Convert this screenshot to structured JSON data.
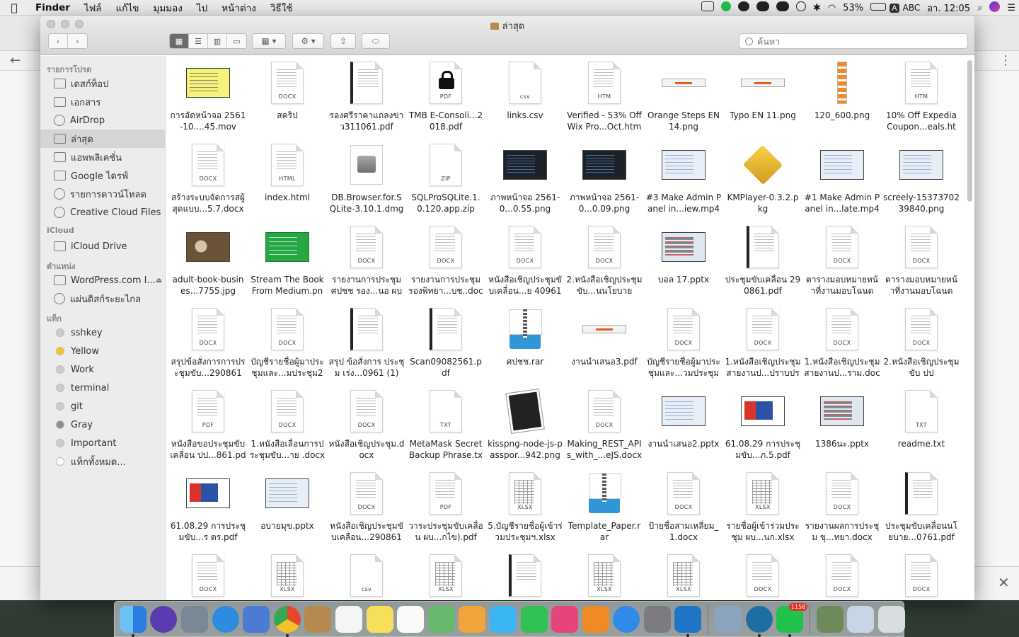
{
  "menubar": {
    "app": "Finder",
    "items": [
      "ไฟล์",
      "แก้ไข",
      "มุมมอง",
      "ไป",
      "หน้าต่าง",
      "วิธีใช้"
    ],
    "battery": "53%",
    "input": "ABC",
    "clock": "อา. 12:05",
    "input_badge": "A"
  },
  "window": {
    "title": "ล่าสุด",
    "search_placeholder": "ค้นหา"
  },
  "sidebar": {
    "favorites_head": "รายการโปรด",
    "favorites": [
      "เดสก์ท็อป",
      "เอกสาร",
      "AirDrop",
      "ล่าสุด",
      "แอพพลิเคชั่น",
      "Google ไดรฟ์",
      "รายการดาวน์โหลด",
      "Creative Cloud Files"
    ],
    "icloud_head": "iCloud",
    "icloud": [
      "iCloud Drive"
    ],
    "locations_head": "ตำแหน่ง",
    "locations": [
      "WordPress.com I...",
      "แผ่นดิสก์ระยะไกล"
    ],
    "tags_head": "แท็ก",
    "tags": [
      {
        "name": "sshkey",
        "color": "#cccccc"
      },
      {
        "name": "Yellow",
        "color": "#f5c518"
      },
      {
        "name": "Work",
        "color": "#cccccc"
      },
      {
        "name": "terminal",
        "color": "#cccccc"
      },
      {
        "name": "git",
        "color": "#cccccc"
      },
      {
        "name": "Gray",
        "color": "#8e8e8e"
      },
      {
        "name": "Important",
        "color": "#cccccc"
      },
      {
        "name": "แท็กทั้งหมด...",
        "color": "#ffffff"
      }
    ]
  },
  "files": [
    {
      "name": "การอัดหน้าจอ 2561-10....45.mov",
      "kind": "shot-yellow"
    },
    {
      "name": "สคริป",
      "kind": "doc",
      "ext": "DOCX"
    },
    {
      "name": "รองศรีราคาแถลงข่าว311061.pdf",
      "kind": "spiral"
    },
    {
      "name": "TMB E-Consoli...2018.pdf",
      "kind": "lock",
      "ext": "PDF"
    },
    {
      "name": "links.csv",
      "kind": "plain",
      "ext": "csv"
    },
    {
      "name": "Verified - 53% Off Wix Pro...Oct.htm",
      "kind": "doc",
      "ext": "HTM"
    },
    {
      "name": "Orange Steps EN 14.png",
      "kind": "banner"
    },
    {
      "name": "Typo EN 11.png",
      "kind": "banner"
    },
    {
      "name": "120_600.png",
      "kind": "tall"
    },
    {
      "name": "10% Off Expedia Coupon...eals.htm",
      "kind": "doc",
      "ext": "HTM"
    },
    {
      "name": "สร้างระบบจัดการสผู้สุดแบบ...5.7.docx",
      "kind": "doc",
      "ext": "DOCX"
    },
    {
      "name": "index.html",
      "kind": "doc",
      "ext": "HTML"
    },
    {
      "name": "DB.Browser.for.SQLite-3.10.1.dmg",
      "kind": "disk"
    },
    {
      "name": "SQLProSQLite.1.0.120.app.zip",
      "kind": "plain",
      "ext": "ZIP"
    },
    {
      "name": "ภาพหน้าจอ 2561-0...0.55.png",
      "kind": "shot"
    },
    {
      "name": "ภาพหน้าจอ 2561-0...0.09.png",
      "kind": "shot"
    },
    {
      "name": "#3 Make Admin Panel in...iew.mp4",
      "kind": "shot-light"
    },
    {
      "name": "KMPlayer-0.3.2.pkg",
      "kind": "pkg"
    },
    {
      "name": "#1 Make Admin Panel in...late.mp4",
      "kind": "shot-light"
    },
    {
      "name": "screely-1537370239840.png",
      "kind": "shot-light"
    },
    {
      "name": "adult-book-busines...7755.jpg",
      "kind": "shot-photo"
    },
    {
      "name": "Stream The Book From Medium.png",
      "kind": "shot-green"
    },
    {
      "name": "รายงานการประชุม ศปชช รอง...นอ ผบช.",
      "kind": "doc",
      "ext": "DOCX"
    },
    {
      "name": "รายงานการประชุม รองพิทยา...บช..docx",
      "kind": "doc",
      "ext": "DOCX"
    },
    {
      "name": "หนังสือเชิญประชุมขับเคลื่อน...ย 40961",
      "kind": "doc",
      "ext": "DOCX"
    },
    {
      "name": "2.หนังสือเชิญประชุมขับ...นนโยบาย",
      "kind": "doc",
      "ext": "DOCX"
    },
    {
      "name": "บอล 17.pptx",
      "kind": "shot-sheet"
    },
    {
      "name": "ประชุมขับเคลื่อน 290861.pdf",
      "kind": "spiral"
    },
    {
      "name": "ตารางมอบหมายหน้าที่งานมอบโฉนด",
      "kind": "doc",
      "ext": "DOCX"
    },
    {
      "name": "ตารางมอบหมายหน้าที่งานมอบโฉนด",
      "kind": "doc",
      "ext": "DOCX"
    },
    {
      "name": "สรุปข้อสั่งการการประชุมขับ...290861",
      "kind": "doc",
      "ext": "DOCX"
    },
    {
      "name": "บัญชีรายชื่อผู้มาประชุมและ...มประชุม2",
      "kind": "doc",
      "ext": "DOCX"
    },
    {
      "name": "สรุป ข้อสั่งการ ประชุม เร่ง...0961 (1)",
      "kind": "spiral"
    },
    {
      "name": "Scan09082561.pdf",
      "kind": "spiral"
    },
    {
      "name": "ศปชช.rar",
      "kind": "zip"
    },
    {
      "name": "งานนำเสนอ3.pdf",
      "kind": "banner"
    },
    {
      "name": "บัญชีรายชื่อผู้มาประชุมและ...วมประชุม",
      "kind": "doc",
      "ext": "DOCX"
    },
    {
      "name": "1.หนังสือเชิญประชุมสายงานป...ปราบปราม",
      "kind": "doc",
      "ext": "DOCX"
    },
    {
      "name": "1.หนังสือเชิญประชุมสายงานป...ราม.docx",
      "kind": "doc",
      "ext": "DOCX"
    },
    {
      "name": "2.หนังสือเชิญประชุมขับ ปป",
      "kind": "doc",
      "ext": "DOCX"
    },
    {
      "name": "หนังสือขอประชุมขับเคลื่อน ปป...861.pdf",
      "kind": "doc",
      "ext": "PDF"
    },
    {
      "name": "1.หนังสือเลื่อนการประชุมขับ...าย .docx",
      "kind": "doc",
      "ext": "DOCX"
    },
    {
      "name": "หนังสือเชิญประชุม.docx",
      "kind": "doc",
      "ext": "DOCX"
    },
    {
      "name": "MetaMask Secret Backup Phrase.txt",
      "kind": "plain",
      "ext": "TXT"
    },
    {
      "name": "kisspng-node-js-passpor...942.png",
      "kind": "kiss"
    },
    {
      "name": "Making_REST_APIs_with_...eJS.docx",
      "kind": "doc",
      "ext": "DOCX"
    },
    {
      "name": "งานนำเสนอ2.pptx",
      "kind": "shot-light"
    },
    {
      "name": "61.08.29 การประชุมขับ...ภ.5.pdf",
      "kind": "shot-redblue"
    },
    {
      "name": "1386นะ.pptx",
      "kind": "shot-sheet"
    },
    {
      "name": "readme.txt",
      "kind": "plain",
      "ext": "TXT"
    },
    {
      "name": "61.08.29 การประชุมขับ...ร ตร.pdf",
      "kind": "shot-redblue"
    },
    {
      "name": "อบายมุข.pptx",
      "kind": "shot-light"
    },
    {
      "name": "หนังสือเชิญประชุมขับเคลื่อน...290861",
      "kind": "doc",
      "ext": "DOCX"
    },
    {
      "name": "วาระประชุมขับเคลื่อน ผบ...กไข).pdf",
      "kind": "doc",
      "ext": "PDF"
    },
    {
      "name": "5.บัญชีรายชื่อผู้เข้าร่วมประชุมฯ.xlsx",
      "kind": "sheet",
      "ext": "XLSX"
    },
    {
      "name": "Template_Paper.rar",
      "kind": "zip"
    },
    {
      "name": "ป้ายชื่อสามเหลี่ยม_1.docx",
      "kind": "doc",
      "ext": "DOCX"
    },
    {
      "name": "รายชื่อผู้เข้าร่วมประชุม ผบ...นก.xlsx",
      "kind": "sheet",
      "ext": "XLSX"
    },
    {
      "name": "รายงานผลการประชุม ขุ...ทยา.docx",
      "kind": "doc",
      "ext": "DOCX"
    },
    {
      "name": "ประชุมขับเคลื่อนนโยบาย...0761.pdf",
      "kind": "spiral"
    },
    {
      "name": "",
      "kind": "doc",
      "ext": "DOCX"
    },
    {
      "name": "",
      "kind": "sheet",
      "ext": "XLSX"
    },
    {
      "name": "",
      "kind": "plain",
      "ext": "csv"
    },
    {
      "name": "",
      "kind": "sheet",
      "ext": "XLSX"
    },
    {
      "name": "",
      "kind": "spiral"
    },
    {
      "name": "",
      "kind": "sheet",
      "ext": "XLSX"
    },
    {
      "name": "",
      "kind": "sheet",
      "ext": "XLSX"
    },
    {
      "name": "",
      "kind": "doc",
      "ext": "DOCX"
    },
    {
      "name": "",
      "kind": "doc",
      "ext": "DOCX"
    },
    {
      "name": "",
      "kind": "doc",
      "ext": "DOCX"
    }
  ],
  "dock": {
    "apps": [
      {
        "name": "finder-icon",
        "color": "#3c8ee8",
        "running": true
      },
      {
        "name": "siri-icon",
        "color": "#5a3bb0",
        "running": false
      },
      {
        "name": "launchpad-icon",
        "color": "#7a8896",
        "running": false
      },
      {
        "name": "safari-icon",
        "color": "#2d8ce0",
        "running": false
      },
      {
        "name": "preview-bird-icon",
        "color": "#4b7bd3",
        "running": false
      },
      {
        "name": "chrome-icon",
        "color": "#e6462d",
        "running": true
      },
      {
        "name": "contacts-icon",
        "color": "#b48a4e",
        "running": false
      },
      {
        "name": "calendar-icon",
        "color": "#f5f5f5",
        "running": false
      },
      {
        "name": "notes-icon",
        "color": "#f6df5b",
        "running": false
      },
      {
        "name": "reminders-icon",
        "color": "#fafafa",
        "running": false
      },
      {
        "name": "maps-icon",
        "color": "#67b96d",
        "running": false
      },
      {
        "name": "photos-icon",
        "color": "#f0a43b",
        "running": false
      },
      {
        "name": "messages-icon",
        "color": "#3ab6f5",
        "running": false
      },
      {
        "name": "facetime-icon",
        "color": "#31c054",
        "running": false
      },
      {
        "name": "itunes-icon",
        "color": "#e6457a",
        "running": false
      },
      {
        "name": "books-icon",
        "color": "#f08a24",
        "running": false
      },
      {
        "name": "app-store-icon",
        "color": "#2f8ae8",
        "running": false
      },
      {
        "name": "system-preferences-icon",
        "color": "#7c7c80",
        "running": false
      },
      {
        "name": "vscode-icon",
        "color": "#2175c7",
        "running": true
      },
      {
        "name": "image-capture-icon",
        "color": "#8ca4bf",
        "running": false
      },
      {
        "name": "wordpress-icon",
        "color": "#1f6ea3",
        "running": true
      },
      {
        "name": "line-icon",
        "color": "#20c24b",
        "running": true
      },
      {
        "name": "documents-icon",
        "color": "#6c8a5a",
        "running": false
      },
      {
        "name": "downloads-stack-icon",
        "color": "#c7d5e4",
        "running": false
      },
      {
        "name": "trash-icon",
        "color": "#d9dde0",
        "running": false
      }
    ],
    "line_badge": "1158"
  }
}
